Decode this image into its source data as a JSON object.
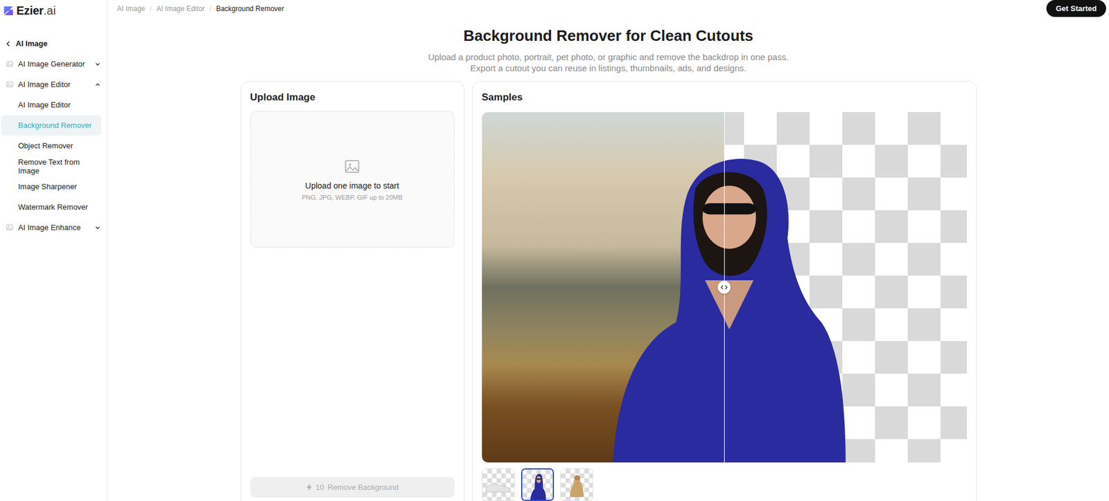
{
  "brand": {
    "name": "Ezier",
    "suffix": ".ai"
  },
  "header": {
    "breadcrumb": [
      {
        "label": "AI Image",
        "current": false
      },
      {
        "label": "AI Image Editor",
        "current": false
      },
      {
        "label": "Background Remover",
        "current": true
      }
    ],
    "separator": "/",
    "cta": "Get Started"
  },
  "sidebar": {
    "back": "AI Image",
    "groups": [
      {
        "label": "AI Image Generator",
        "expanded": false,
        "children": []
      },
      {
        "label": "AI Image Editor",
        "expanded": true,
        "children": [
          {
            "label": "AI Image Editor",
            "selected": false
          },
          {
            "label": "Background Remover",
            "selected": true
          },
          {
            "label": "Object Remover",
            "selected": false
          },
          {
            "label": "Remove Text from Image",
            "selected": false
          },
          {
            "label": "Image Sharpener",
            "selected": false
          },
          {
            "label": "Watermark Remover",
            "selected": false
          }
        ]
      },
      {
        "label": "AI Image Enhance",
        "expanded": false,
        "children": []
      }
    ]
  },
  "hero": {
    "title": "Background Remover for Clean Cutouts",
    "subtitle": "Upload a product photo, portrait, pet photo, or graphic and remove the backdrop in one pass. Export a cutout you can reuse in listings, thumbnails, ads, and designs."
  },
  "upload": {
    "title": "Upload Image",
    "dropzone": {
      "text": "Upload one image to start",
      "hint": "PNG, JPG, WEBP, GIF up to 20MB"
    },
    "button": {
      "credits": "10",
      "label": "Remove Background",
      "disabled": true
    }
  },
  "samples": {
    "title": "Samples",
    "compare": {
      "level": 0.5
    },
    "thumbnails": [
      {
        "kind": "shoe",
        "selected": false
      },
      {
        "kind": "portrait",
        "selected": true
      },
      {
        "kind": "dog",
        "selected": false
      }
    ]
  }
}
